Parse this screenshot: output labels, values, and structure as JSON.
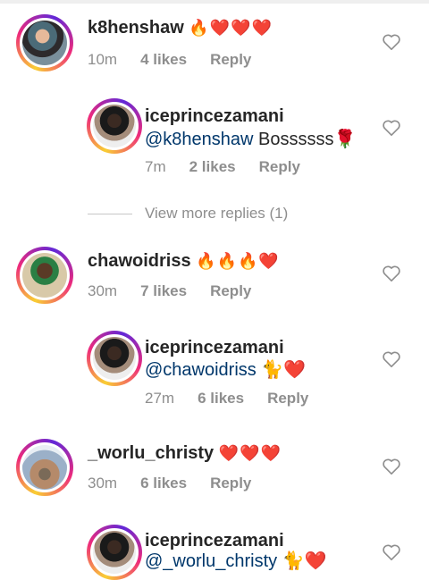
{
  "comments": [
    {
      "username": "k8henshaw",
      "text": "🔥❤️❤️❤️",
      "time": "10m",
      "likes": "4 likes",
      "reply": "Reply",
      "avatar_icon": "user-avatar-k8henshaw",
      "replies": [
        {
          "username": "iceprincezamani",
          "mention": "@k8henshaw",
          "text": " Bossssss🌹",
          "time": "7m",
          "likes": "2 likes",
          "reply": "Reply"
        }
      ],
      "view_more": "View more replies (1)"
    },
    {
      "username": "chawoidriss",
      "text": "🔥🔥🔥❤️",
      "time": "30m",
      "likes": "7 likes",
      "reply": "Reply",
      "replies": [
        {
          "username": "iceprincezamani",
          "mention": "@chawoidriss",
          "text": " 🐈❤️",
          "time": "27m",
          "likes": "6 likes",
          "reply": "Reply"
        }
      ]
    },
    {
      "username": "_worlu_christy",
      "text": "❤️❤️❤️",
      "time": "30m",
      "likes": "6 likes",
      "reply": "Reply",
      "replies": [
        {
          "username": "iceprincezamani",
          "mention": "@_worlu_christy",
          "text": " 🐈❤️"
        }
      ]
    }
  ],
  "colors": {
    "mention": "#00376b",
    "meta": "#8e8e8e",
    "text": "#262626"
  },
  "icons": {
    "like": "heart-outline-icon"
  }
}
